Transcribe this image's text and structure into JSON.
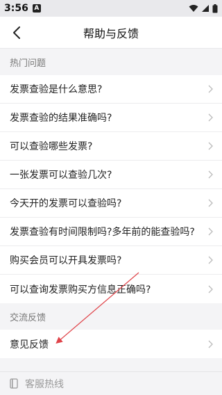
{
  "status_bar": {
    "time": "3:56",
    "notification_letter": "A"
  },
  "nav": {
    "title": "帮助与反馈"
  },
  "hot_section": {
    "header": "热门问题",
    "items": [
      {
        "label": "发票查验是什么意思?"
      },
      {
        "label": "发票查验的结果准确吗?"
      },
      {
        "label": "可以查验哪些发票?"
      },
      {
        "label": "一张发票可以查验几次?"
      },
      {
        "label": "今天开的发票可以查验吗?"
      },
      {
        "label": "发票查验有时间限制吗?多年前的能查验吗?"
      },
      {
        "label": "购买会员可以开具发票吗?"
      },
      {
        "label": "可以查询发票购买方信息正确吗?"
      }
    ]
  },
  "feedback_section": {
    "header": "交流反馈",
    "items": [
      {
        "label": "意见反馈"
      }
    ]
  },
  "footer": {
    "label": "客服热线"
  },
  "colors": {
    "background": "#f4f4f6",
    "annotation_arrow": "#e0444a"
  }
}
